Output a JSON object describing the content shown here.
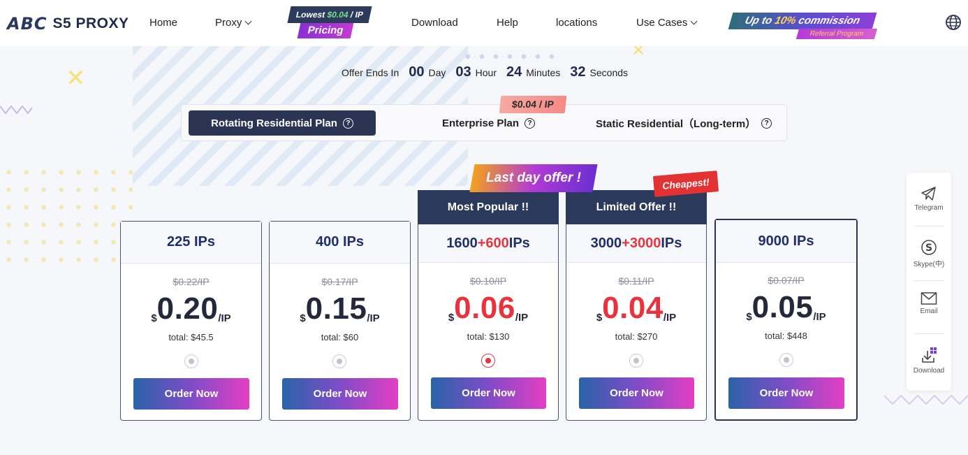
{
  "header": {
    "logo_mark": "ABC",
    "logo_text": "S5 PROXY",
    "nav": [
      {
        "label": "Home"
      },
      {
        "label": "Proxy",
        "dropdown": true
      },
      {
        "label": "Download"
      },
      {
        "label": "Help"
      },
      {
        "label": "locations"
      },
      {
        "label": "Use Cases",
        "dropdown": true
      }
    ],
    "pricing_badge": {
      "top_prefix": "Lowest",
      "top_price": "$0.04",
      "top_suffix": "/ IP",
      "label": "Pricing"
    },
    "commission": {
      "prefix": "Up to",
      "percent": "10%",
      "suffix": "commission",
      "sub": "Referral Program"
    },
    "globe_icon": "globe-icon"
  },
  "countdown": {
    "label": "Offer Ends In",
    "days": "00",
    "days_unit": "Day",
    "hours": "03",
    "hours_unit": "Hour",
    "minutes": "24",
    "minutes_unit": "Minutes",
    "seconds": "32",
    "seconds_unit": "Seconds"
  },
  "plans": {
    "tabs": [
      {
        "label": "Rotating Residential Plan",
        "active": true
      },
      {
        "label": "Enterprise Plan"
      },
      {
        "label": "Static Residential（Long-term）"
      }
    ],
    "enterprise_badge": "$0.04 / IP"
  },
  "badges": {
    "last_day": "Last day offer !",
    "cheapest": "Cheapest!"
  },
  "cards": [
    {
      "head": "225 IPs",
      "old": "$0.22/IP",
      "currency": "$",
      "price": "0.20",
      "unit": "/IP",
      "total_label": "total:",
      "total": "$45.5",
      "order": "Order Now",
      "selected": false
    },
    {
      "head": "400 IPs",
      "old": "$0.17/IP",
      "currency": "$",
      "price": "0.15",
      "unit": "/IP",
      "total_label": "total:",
      "total": "$60",
      "order": "Order Now",
      "selected": false
    },
    {
      "ribbon": "Most Popular !!",
      "head_base": "1600",
      "head_bonus": "+600",
      "head_suffix": "IPs",
      "old": "$0.10/IP",
      "currency": "$",
      "price": "0.06",
      "unit": "/IP",
      "total_label": "total:",
      "total": "$130",
      "order": "Order Now",
      "selected": true
    },
    {
      "ribbon": "Limited Offer !!",
      "head_base": "3000",
      "head_bonus": "+3000",
      "head_suffix": "IPs",
      "old": "$0.11/IP",
      "currency": "$",
      "price": "0.04",
      "unit": "/IP",
      "total_label": "total:",
      "total": "$270",
      "order": "Order Now",
      "selected": false
    },
    {
      "head": "9000 IPs",
      "old": "$0.07/IP",
      "currency": "$",
      "price": "0.05",
      "unit": "/IP",
      "total_label": "total:",
      "total": "$448",
      "order": "Order Now",
      "selected": false
    }
  ],
  "side": [
    {
      "label": "Telegram",
      "icon": "telegram-icon"
    },
    {
      "label": "Skype(中)",
      "icon": "skype-icon"
    },
    {
      "label": "Email",
      "icon": "email-icon"
    },
    {
      "label": "Download",
      "icon": "download-icon"
    }
  ],
  "colors": {
    "navy": "#2b3453",
    "accent_red": "#e8333f",
    "gradient_start": "#2a63a8",
    "gradient_end": "#e43fc4"
  }
}
